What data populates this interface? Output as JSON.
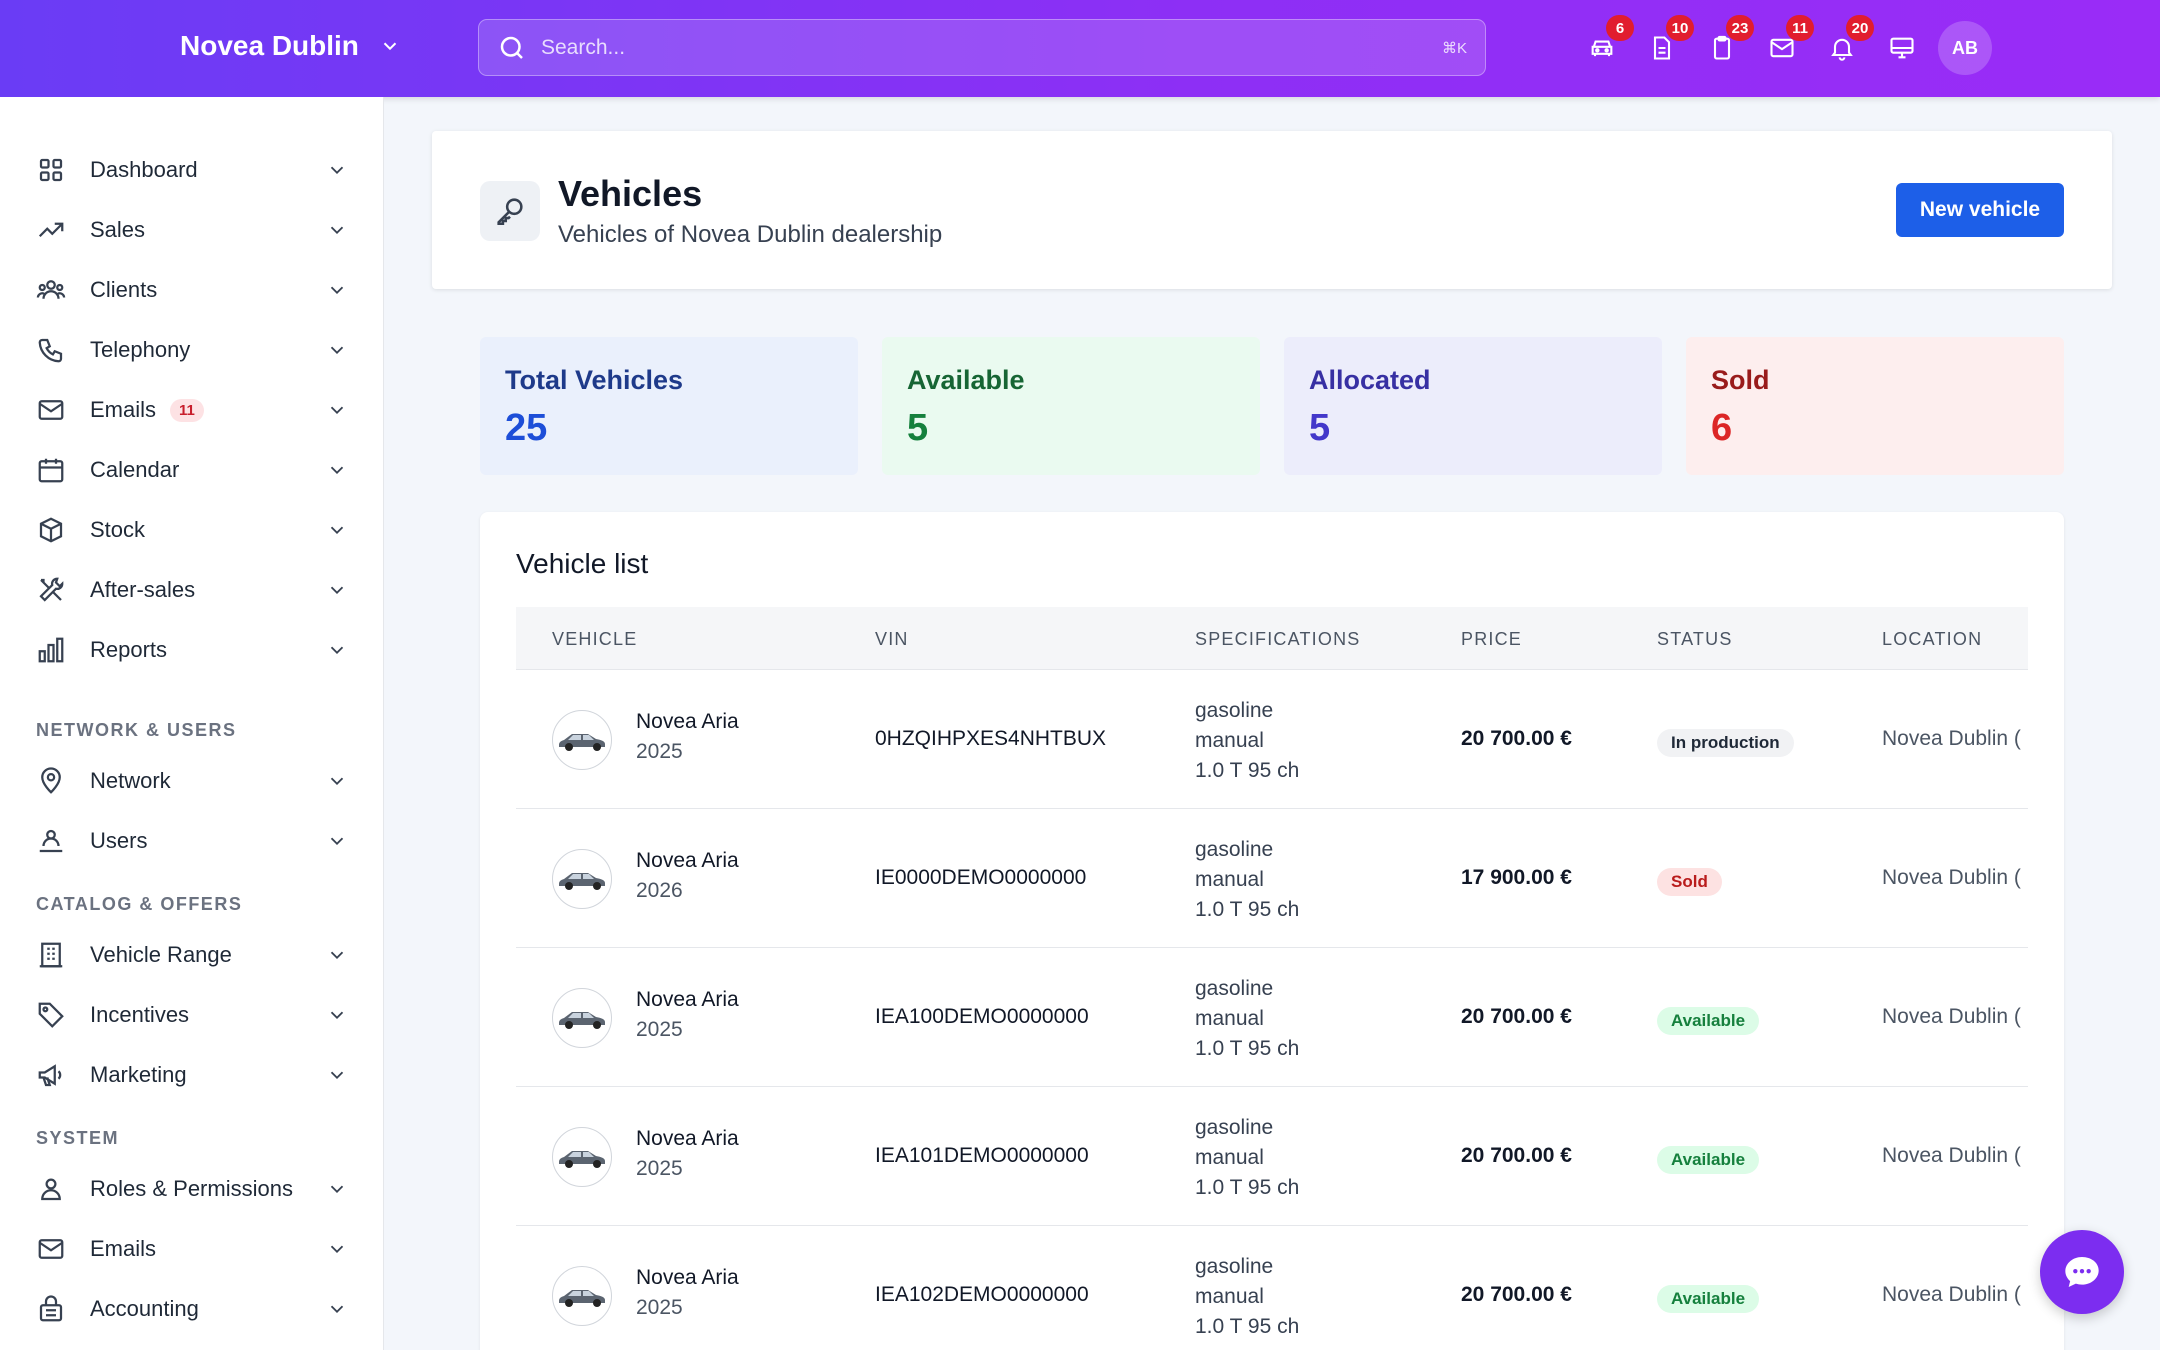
{
  "header": {
    "brand": "Novea Dublin",
    "search_placeholder": "Search...",
    "search_shortcut": "⌘K",
    "icons": [
      {
        "name": "car-icon",
        "badge": "6"
      },
      {
        "name": "document-icon",
        "badge": "10"
      },
      {
        "name": "clipboard-icon",
        "badge": "23"
      },
      {
        "name": "mail-icon",
        "badge": "11"
      },
      {
        "name": "bell-icon",
        "badge": "20"
      },
      {
        "name": "monitor-icon",
        "badge": ""
      }
    ],
    "avatar": "AB"
  },
  "sidebar": {
    "items": [
      {
        "label": "Dashboard",
        "icon": "grid-icon"
      },
      {
        "label": "Sales",
        "icon": "trending-up-icon"
      },
      {
        "label": "Clients",
        "icon": "users-icon"
      },
      {
        "label": "Telephony",
        "icon": "phone-icon"
      },
      {
        "label": "Emails",
        "icon": "mail-icon",
        "badge": "11"
      },
      {
        "label": "Calendar",
        "icon": "calendar-icon"
      },
      {
        "label": "Stock",
        "icon": "box-icon"
      },
      {
        "label": "After-sales",
        "icon": "tools-icon"
      },
      {
        "label": "Reports",
        "icon": "bar-chart-icon"
      }
    ],
    "sections": [
      {
        "title": "NETWORK & USERS",
        "items": [
          {
            "label": "Network",
            "icon": "map-pin-icon"
          },
          {
            "label": "Users",
            "icon": "user-network-icon"
          }
        ]
      },
      {
        "title": "CATALOG & OFFERS",
        "items": [
          {
            "label": "Vehicle Range",
            "icon": "building-icon"
          },
          {
            "label": "Incentives",
            "icon": "tag-icon"
          },
          {
            "label": "Marketing",
            "icon": "megaphone-icon"
          }
        ]
      },
      {
        "title": "SYSTEM",
        "items": [
          {
            "label": "Roles & Permissions",
            "icon": "user-icon"
          },
          {
            "label": "Emails",
            "icon": "mail-icon"
          },
          {
            "label": "Accounting",
            "icon": "lock-box-icon"
          }
        ]
      }
    ]
  },
  "page": {
    "title": "Vehicles",
    "subtitle": "Vehicles of Novea Dublin dealership",
    "new_button": "New vehicle"
  },
  "stats": [
    {
      "label": "Total Vehicles",
      "value": "25",
      "bg": "#eaf0fc",
      "color": "#1e3a8a",
      "valueColor": "#1d4ed8"
    },
    {
      "label": "Available",
      "value": "5",
      "bg": "#eafaf0",
      "color": "#166534",
      "valueColor": "#15803d"
    },
    {
      "label": "Allocated",
      "value": "5",
      "bg": "#ecedfb",
      "color": "#3730a3",
      "valueColor": "#4338ca"
    },
    {
      "label": "Sold",
      "value": "6",
      "bg": "#fdeeee",
      "color": "#991b1b",
      "valueColor": "#dc2626"
    }
  ],
  "table": {
    "title": "Vehicle list",
    "columns": [
      "VEHICLE",
      "VIN",
      "SPECIFICATIONS",
      "PRICE",
      "STATUS",
      "LOCATION"
    ],
    "rows": [
      {
        "name": "Novea Aria",
        "year": "2025",
        "vin": "0HZQIHPXES4NHTBUX",
        "fuel": "gasoline",
        "gearbox": "manual",
        "engine": "1.0 T 95 ch",
        "price": "20 700.00 €",
        "status": "In production",
        "status_kind": "prod",
        "location": "Novea Dublin ("
      },
      {
        "name": "Novea Aria",
        "year": "2026",
        "vin": "IE0000DEMO0000000",
        "fuel": "gasoline",
        "gearbox": "manual",
        "engine": "1.0 T 95 ch",
        "price": "17 900.00 €",
        "status": "Sold",
        "status_kind": "sold",
        "location": "Novea Dublin ("
      },
      {
        "name": "Novea Aria",
        "year": "2025",
        "vin": "IEA100DEMO0000000",
        "fuel": "gasoline",
        "gearbox": "manual",
        "engine": "1.0 T 95 ch",
        "price": "20 700.00 €",
        "status": "Available",
        "status_kind": "avail",
        "location": "Novea Dublin ("
      },
      {
        "name": "Novea Aria",
        "year": "2025",
        "vin": "IEA101DEMO0000000",
        "fuel": "gasoline",
        "gearbox": "manual",
        "engine": "1.0 T 95 ch",
        "price": "20 700.00 €",
        "status": "Available",
        "status_kind": "avail",
        "location": "Novea Dublin ("
      },
      {
        "name": "Novea Aria",
        "year": "2025",
        "vin": "IEA102DEMO0000000",
        "fuel": "gasoline",
        "gearbox": "manual",
        "engine": "1.0 T 95 ch",
        "price": "20 700.00 €",
        "status": "Available",
        "status_kind": "avail",
        "location": "Novea Dublin ("
      }
    ]
  },
  "chat_icon": "chat-bubble-icon"
}
